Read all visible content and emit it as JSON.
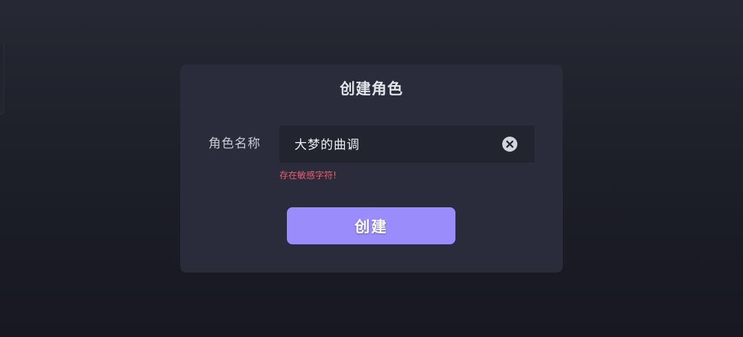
{
  "dialog": {
    "title": "创建角色",
    "name_field": {
      "label": "角色名称",
      "value": "大梦的曲调",
      "clear_icon": "close-circle-icon"
    },
    "error_message": "存在敏感字符!",
    "create_button_label": "创建"
  },
  "colors": {
    "dialog_background": "#2a2c3b",
    "input_background": "#22242f",
    "accent": "#9a8cfb",
    "error": "#ee5d6c"
  }
}
